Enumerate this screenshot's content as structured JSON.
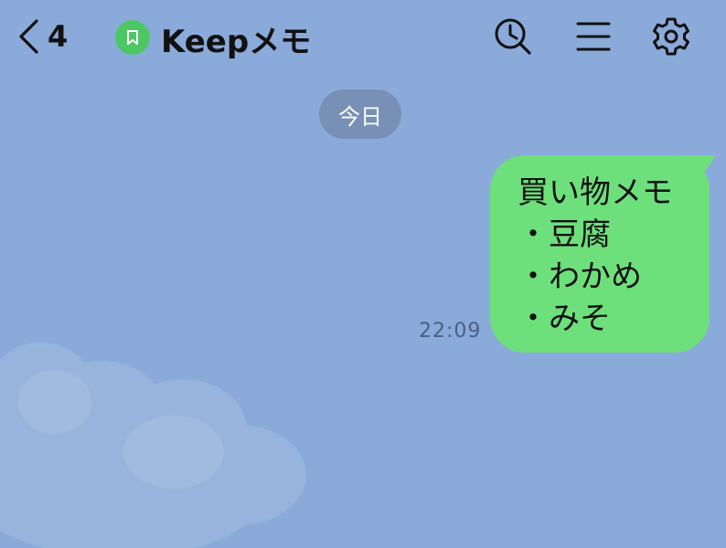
{
  "header": {
    "unread_count": "4",
    "title": "Keepメモ"
  },
  "chat": {
    "date_label": "今日",
    "message": {
      "lines": [
        "買い物メモ",
        "・豆腐",
        "・わかめ",
        "・みそ"
      ],
      "time": "22:09"
    }
  },
  "colors": {
    "background": "#8aaad9",
    "bubble": "#6ee07b",
    "keep_badge": "#4cc764",
    "date_pill": "#7890b6"
  },
  "icons": [
    "chevron-left-icon",
    "keep-bookmark-icon",
    "search-clock-icon",
    "menu-icon",
    "gear-icon"
  ]
}
